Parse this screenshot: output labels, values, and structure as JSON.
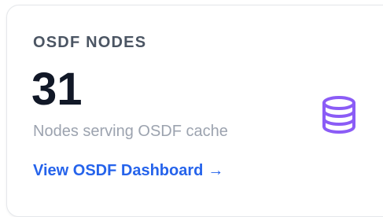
{
  "card": {
    "title": "OSDF NODES",
    "value": "31",
    "description": "Nodes serving OSDF cache",
    "link_label": "View OSDF Dashboard",
    "link_arrow": "→"
  },
  "icon": {
    "name": "database-icon",
    "color": "#8b5cf6"
  },
  "colors": {
    "title": "#4b5563",
    "value": "#111827",
    "description": "#9ca3af",
    "link": "#2563eb"
  }
}
